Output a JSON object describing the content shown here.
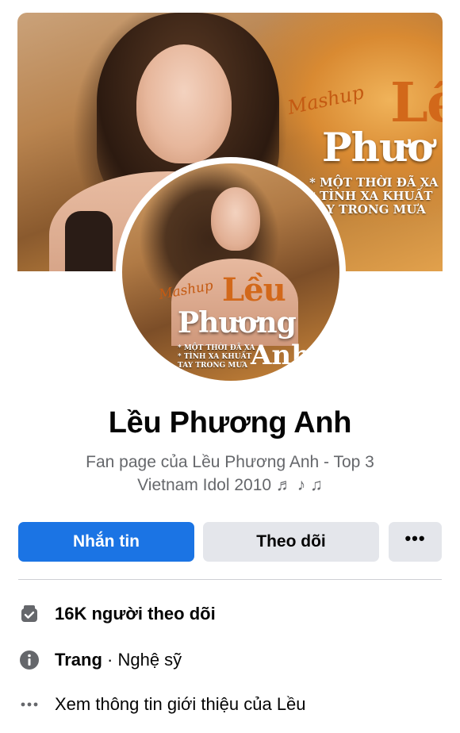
{
  "cover": {
    "script_text": "Mashup",
    "title_line1": "Lều",
    "title_line2": "Phươ",
    "songs": [
      "* MỘT THỜI ĐÃ XA",
      "* TÌNH XA KHUẤT",
      "TAY TRONG MƯA"
    ]
  },
  "avatar": {
    "script_text": "Mashup",
    "title_line1": "Lều",
    "title_line2": "Phương",
    "title_line3": "Anh",
    "songs": [
      "* MỘT THỜI ĐÃ XA",
      "* TÌNH XA KHUẤT",
      "TAY TRONG MƯA"
    ]
  },
  "page": {
    "name": "Lều Phương Anh",
    "bio_line1": "Fan page của Lều Phương Anh - Top 3",
    "bio_line2": "Vietnam Idol 2010 ♬ ♪ ♫"
  },
  "actions": {
    "message_label": "Nhắn tin",
    "follow_label": "Theo dõi",
    "more_label": "•••"
  },
  "info": {
    "followers": "16K người theo dõi",
    "page_type_label": "Trang",
    "page_type_sep": " · ",
    "page_type_value": "Nghệ sỹ",
    "about_link": "Xem thông tin giới thiệu của Lều"
  },
  "colors": {
    "primary": "#1b74e4",
    "secondary_button": "#e4e6eb",
    "muted_text": "#65676b",
    "icon": "#65676b"
  },
  "icons": [
    "followers-icon",
    "info-icon",
    "more-dots-icon"
  ]
}
